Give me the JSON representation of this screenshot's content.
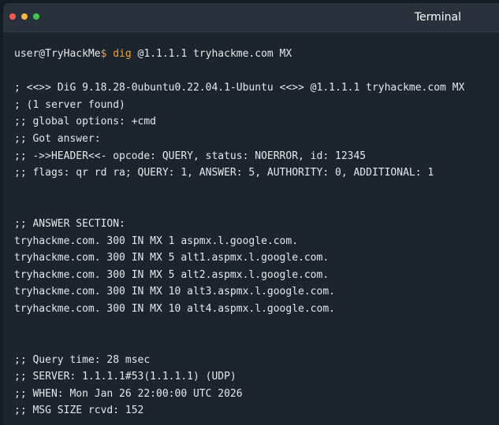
{
  "window": {
    "title": "Terminal",
    "dots": [
      "#f25a55",
      "#f6b73c",
      "#3cc94a"
    ]
  },
  "prompt": {
    "user_host": "user@TryHackMe",
    "sign": "$",
    "command": "dig",
    "args": "@1.1.1.1 tryhackme.com MX"
  },
  "header_lines": [
    "; <<>> DiG 9.18.28-0ubuntu0.22.04.1-Ubuntu <<>> @1.1.1.1 tryhackme.com MX",
    "; (1 server found)",
    ";; global options: +cmd",
    ";; Got answer:",
    ";; ->>HEADER<<- opcode: QUERY, status: NOERROR, id: 12345",
    ";; flags: qr rd ra; QUERY: 1, ANSWER: 5, AUTHORITY: 0, ADDITIONAL: 1"
  ],
  "answer_section": {
    "heading": ";; ANSWER SECTION:",
    "records": [
      "tryhackme.com. 300 IN MX 1 aspmx.l.google.com.",
      "tryhackme.com. 300 IN MX 5 alt1.aspmx.l.google.com.",
      "tryhackme.com. 300 IN MX 5 alt2.aspmx.l.google.com.",
      "tryhackme.com. 300 IN MX 10 alt3.aspmx.l.google.com.",
      "tryhackme.com. 300 IN MX 10 alt4.aspmx.l.google.com."
    ]
  },
  "stats_lines": [
    ";; Query time: 28 msec",
    ";; SERVER: 1.1.1.1#53(1.1.1.1) (UDP)",
    ";; WHEN: Mon Jan 26 22:00:00 UTC 2026",
    ";; MSG SIZE rcvd: 152"
  ]
}
